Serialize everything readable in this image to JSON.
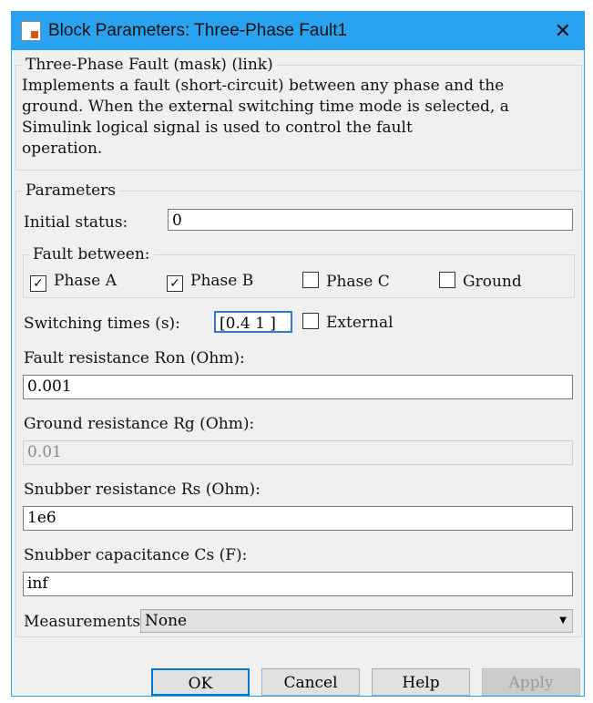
{
  "window": {
    "title": "Block Parameters: Three-Phase Fault1"
  },
  "mask": {
    "legend": "Three-Phase Fault (mask) (link)",
    "description_lines": [
      "Implements a fault (short-circuit) between any phase and the",
      "ground. When the external switching time mode is selected, a",
      "Simulink logical signal is used to control the fault",
      "operation."
    ]
  },
  "params": {
    "legend": "Parameters",
    "initial_status": {
      "label": "Initial status:",
      "value": "0"
    },
    "fault_between": {
      "legend": "Fault between:",
      "phase_a": {
        "label": "Phase A",
        "checked": true
      },
      "phase_b": {
        "label": "Phase B",
        "checked": true
      },
      "phase_c": {
        "label": "Phase C",
        "checked": false
      },
      "ground": {
        "label": "Ground",
        "checked": false
      }
    },
    "switching_times": {
      "label": "Switching times (s):",
      "value": "[0.4 1 ]"
    },
    "external": {
      "label": "External",
      "checked": false
    },
    "ron": {
      "label": "Fault resistance Ron (Ohm):",
      "value": "0.001"
    },
    "rg": {
      "label": "Ground resistance Rg (Ohm):",
      "value": "0.01"
    },
    "rs": {
      "label": "Snubber resistance Rs (Ohm):",
      "value": "1e6"
    },
    "cs": {
      "label": "Snubber capacitance Cs (F):",
      "value": "inf"
    },
    "measurements": {
      "label": "Measurements",
      "value": "None"
    }
  },
  "buttons": {
    "ok": "OK",
    "cancel": "Cancel",
    "help": "Help",
    "apply": "Apply"
  },
  "check": "✓"
}
